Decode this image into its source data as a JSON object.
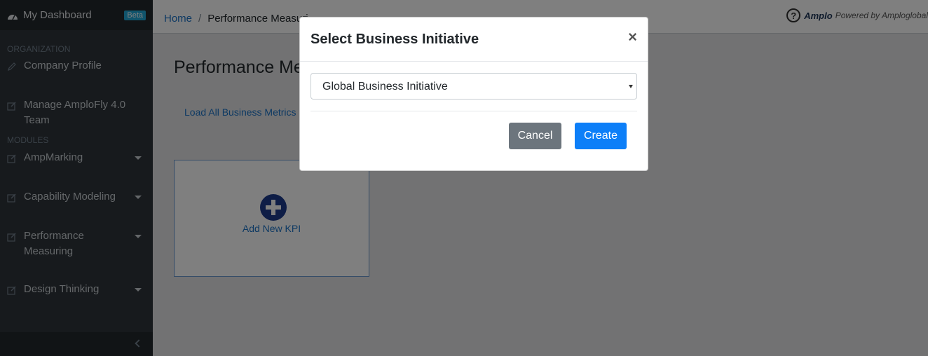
{
  "sidebar": {
    "brand": "My Dashboard",
    "badge": "Beta",
    "sections": {
      "organization": "ORGANIZATION",
      "modules": "MODULES"
    },
    "items": [
      {
        "label": "Company Profile",
        "icon": "pencil-icon"
      },
      {
        "label": "Manage AmploFly 4.0 Team",
        "icon": "edit-icon"
      },
      {
        "label": "AmpMarking",
        "icon": "edit-icon"
      },
      {
        "label": "Capability Modeling",
        "icon": "edit-icon"
      },
      {
        "label": "Performance Measuring",
        "icon": "edit-icon"
      },
      {
        "label": "Design Thinking",
        "icon": "edit-icon"
      }
    ]
  },
  "header": {
    "breadcrumb": {
      "home": "Home",
      "separator": "/",
      "current": "Performance Measuri"
    },
    "amplo": "Amplo",
    "powered": "Powered by Amploglobal"
  },
  "main": {
    "title": "Performance Me",
    "load_link": "Load All Business Metrics",
    "add_kpi": "Add New KPI"
  },
  "modal": {
    "title": "Select Business Initiative",
    "close": "×",
    "selected_initiative": "Global Business Initiative",
    "cancel_label": "Cancel",
    "create_label": "Create"
  },
  "colors": {
    "sidebar_bg": "#2f353a",
    "primary": "#0d7ff8",
    "secondary": "#6c757d",
    "link": "#1b73c7"
  }
}
